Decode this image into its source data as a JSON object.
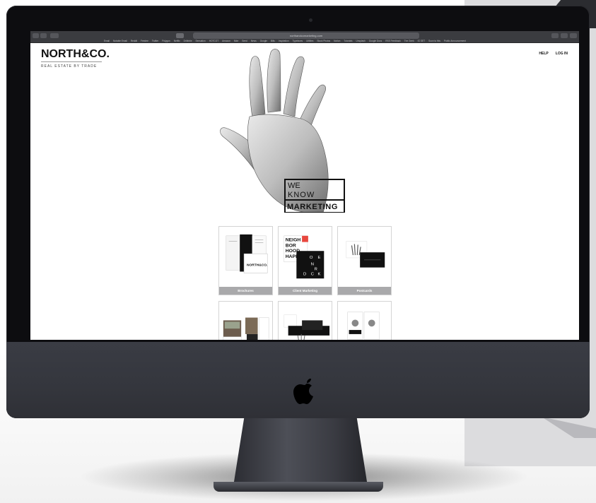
{
  "browser": {
    "url": "northandcomarketing.com",
    "favorites": [
      "Email",
      "Notable Email",
      "Reddit",
      "Feedee",
      "Twitter",
      "Polygon",
      "Netflix",
      "Dribbble",
      "Sensation",
      "HOTCOT",
      "Amazon",
      "Nike",
      "Seed",
      "News",
      "Google",
      "Bills",
      "Inspiration",
      "Typefaces",
      "Utilities",
      "Stock Photos",
      "Notion",
      "Tutorials",
      "Unsplash",
      "Google Docs",
      "RSS Feedback",
      "The Geek",
      "IG SET",
      "Soon to this",
      "Public Announcement"
    ]
  },
  "site": {
    "brand_name": "NORTH&CO.",
    "tagline": "REAL ESTATE BY TRADE",
    "nav": {
      "help": "HELP",
      "login": "LOG IN"
    },
    "hero_words": [
      "WE",
      "KNOW",
      "MARKETING"
    ],
    "tiles": [
      {
        "label": "Brochures"
      },
      {
        "label": "Client Marketing"
      },
      {
        "label": "Postcards"
      }
    ],
    "tile_art_text": {
      "brochure_brand": "NORTH&CO.",
      "neighborhood": [
        "NEIGH",
        "BOR",
        "HOOD",
        "HAPP"
      ],
      "ondeck": [
        "O",
        "E",
        "N",
        "R",
        "D",
        "C",
        "K"
      ]
    }
  },
  "colors": {
    "accent": "#111111",
    "caption_bg": "#a9a9ab",
    "bezel": "#0d0d10",
    "chin": "#36383f"
  },
  "icons": [
    "apple-logo-icon",
    "back-icon",
    "forward-icon",
    "sidebar-icon",
    "share-icon",
    "new-tab-icon"
  ]
}
